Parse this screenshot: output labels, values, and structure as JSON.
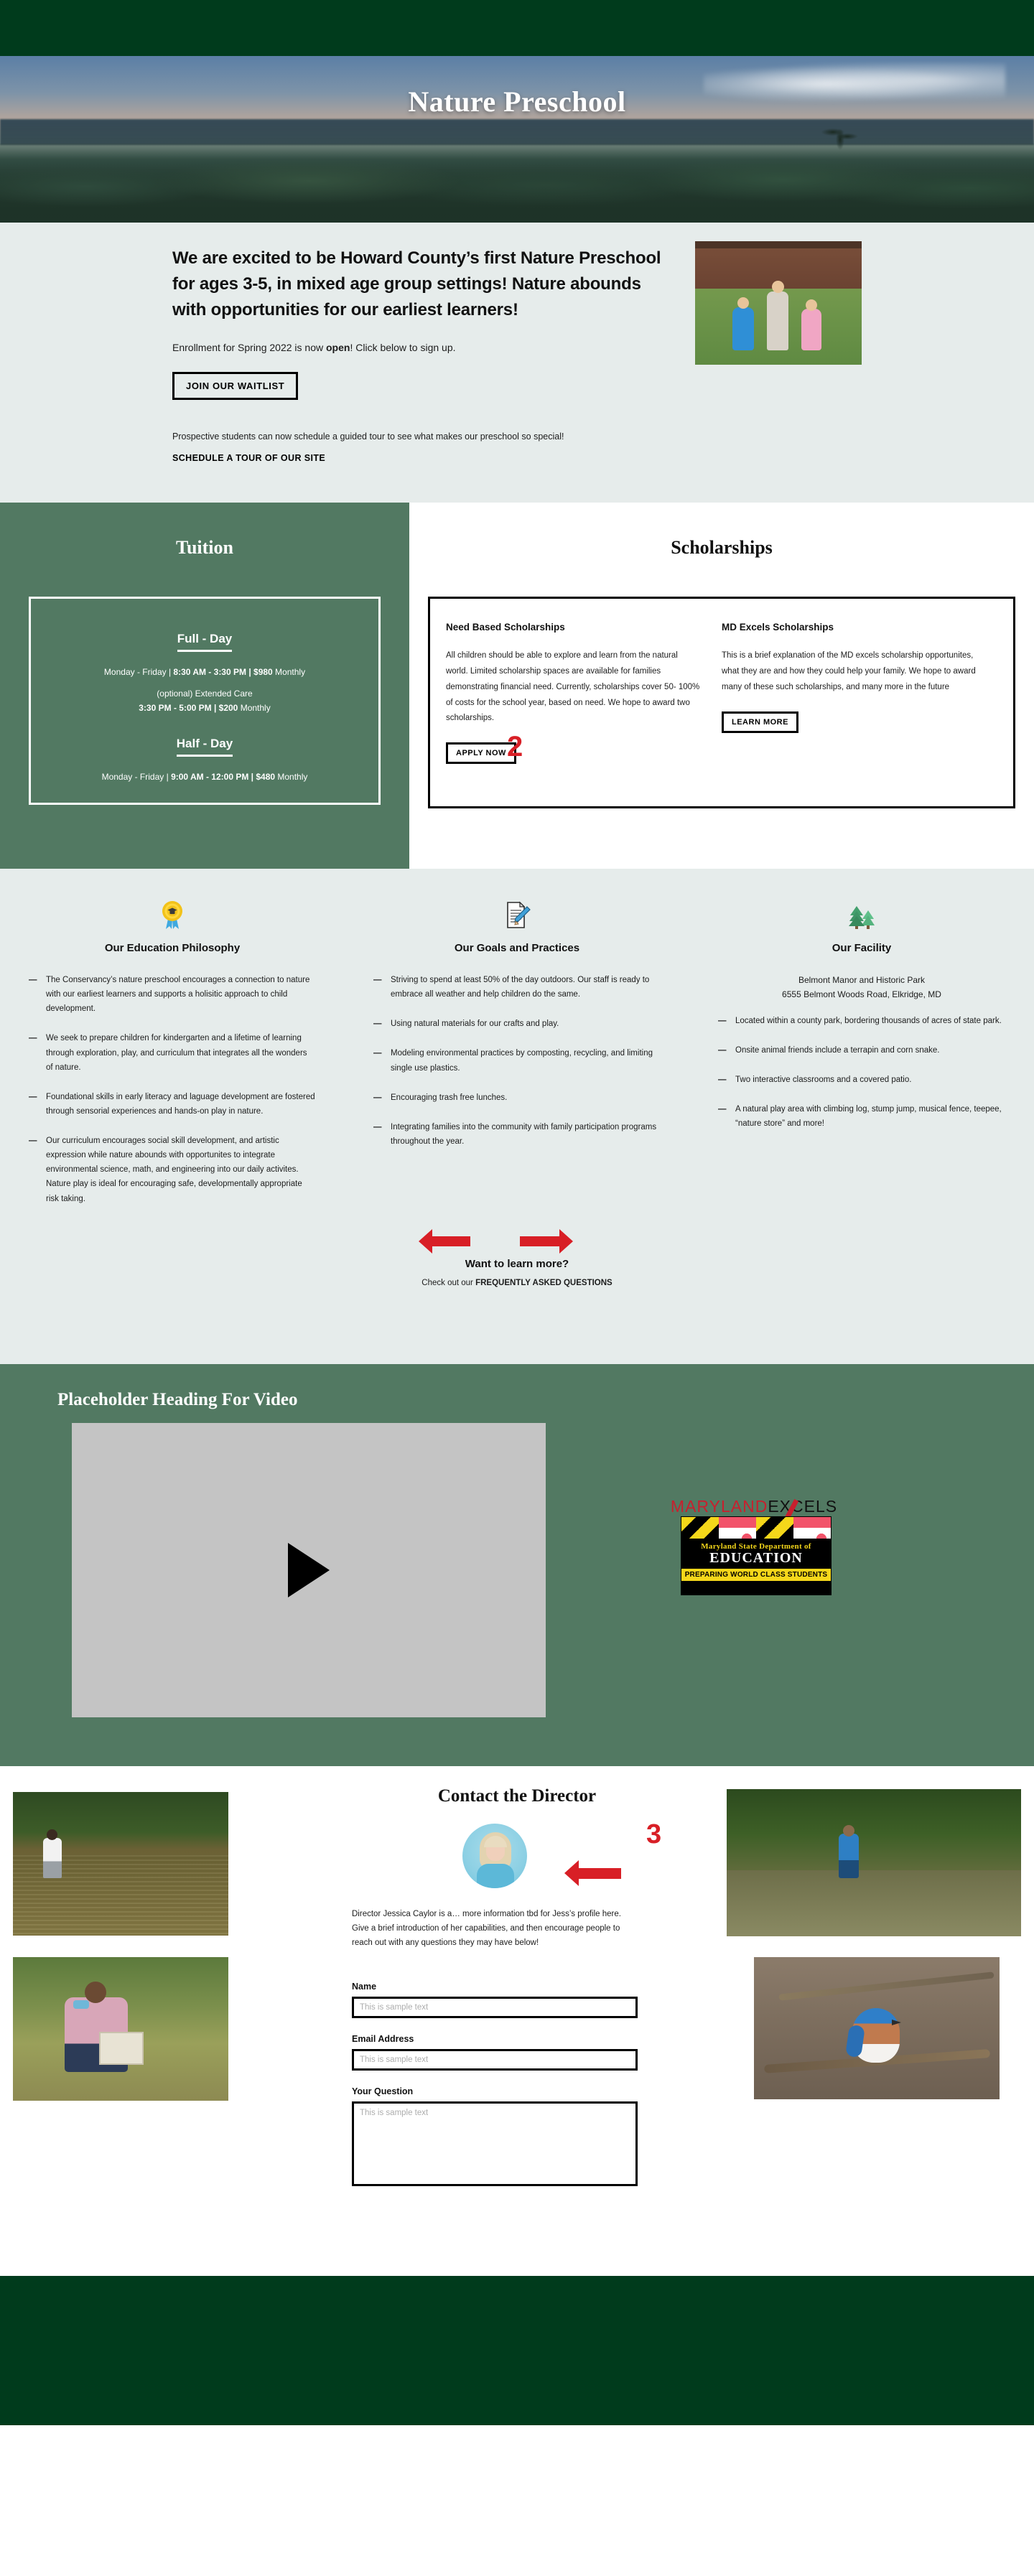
{
  "hero": {
    "title": "Nature Preschool"
  },
  "intro": {
    "heading": "We are excited to be Howard County’s first Nature Preschool for ages 3-5, in mixed age group settings! Nature abounds with opportunities for our earliest learners!",
    "enroll_prefix": "Enrollment for Spring 2022 is now ",
    "enroll_bold": "open",
    "enroll_suffix": "! Click below to sign up.",
    "waitlist_button": "JOIN OUR WAITLIST",
    "tour_text": "Prospective students can now schedule a guided tour to see what makes our preschool so special!",
    "tour_link": "SCHEDULE A TOUR OF OUR SITE"
  },
  "annotations": {
    "one": "1",
    "two": "2",
    "three": "3"
  },
  "tuition": {
    "title": "Tuition",
    "full_day_title": "Full - Day",
    "full_day_line_1a": "Monday - Friday | ",
    "full_day_line_1b": "8:30 AM - 3:30 PM | $980",
    "full_day_line_1c": " Monthly",
    "extended_label": "(optional) Extended Care",
    "extended_time_b": "3:30 PM - 5:00 PM | $200",
    "extended_time_c": " Monthly",
    "half_day_title": "Half - Day",
    "half_day_line_1a": "Monday - Friday | ",
    "half_day_line_1b": "9:00 AM - 12:00 PM | $480",
    "half_day_line_1c": " Monthly"
  },
  "scholarships": {
    "title": "Scholarships",
    "cards": [
      {
        "title": "Need Based Scholarships",
        "body": "All children should be able to explore and learn from the natural world. Limited scholarship spaces are available for families demonstrating financial need. Currently, scholarships cover 50- 100% of costs for the school year, based on need. We hope to award two scholarships.",
        "button": "APPLY NOW"
      },
      {
        "title": "MD Excels Scholarships",
        "body": "This is a brief explanation of the MD excels scholarship opportunites, what they are and how they could help your family. We hope to award many of these such scholarships, and many more in the future",
        "button": "LEARN MORE"
      }
    ]
  },
  "columns": [
    {
      "icon": "award-ribbon-icon",
      "heading": "Our Education Philosophy",
      "bullets": [
        "The Conservancy’s nature preschool encourages a connection to nature with our earliest learners and supports a holisitic approach to child development.",
        "We seek to prepare children for kindergarten and a lifetime of learning through exploration, play, and curriculum that integrates all the wonders of nature.",
        "Foundational skills in early literacy and laguage development are fostered through sensorial experiences and hands-on play in nature.",
        "Our curriculum encourages social skill development, and artistic expression while nature abounds with opportunites to integrate environmental science, math, and engineering into our daily activites. Nature play is ideal for encouraging safe, developmentally appropriate risk taking."
      ]
    },
    {
      "icon": "memo-pencil-icon",
      "heading": "Our Goals and Practices",
      "bullets": [
        "Striving to spend at least 50% of the day outdoors. Our staff is ready to embrace all weather and help children do the same.",
        "Using natural materials for our crafts and play.",
        "Modeling environmental practices by composting, recycling, and limiting  single use plastics.",
        "Encouraging trash free lunches.",
        "Integrating families into the community with family participation programs throughout the year."
      ]
    },
    {
      "icon": "evergreen-trees-icon",
      "heading": "Our Facility",
      "address_line_1": "Belmont Manor and Historic Park",
      "address_line_2": "6555 Belmont Woods Road, Elkridge, MD",
      "bullets": [
        "Located within a county park, bordering thousands of acres of state park.",
        "Onsite animal friends include a terrapin and corn snake.",
        "Two interactive classrooms and a covered patio.",
        "A natural play area with climbing log, stump jump, musical fence, teepee, “nature store” and more!"
      ]
    }
  ],
  "learn_more": {
    "heading": "Want to learn more?",
    "prefix": "Check out our ",
    "link": "FREQUENTLY ASKED QUESTIONS"
  },
  "video": {
    "heading": "Placeholder Heading For Video",
    "play_icon": "play-triangle-icon"
  },
  "badges": {
    "md_excels_red": "MARYLAND",
    "md_excels_black": "EXCELS",
    "msde_line1": "Maryland State Department of",
    "msde_line2": "EDUCATION",
    "msde_line3": "PREPARING WORLD CLASS STUDENTS"
  },
  "contact": {
    "title": "Contact the Director",
    "bio": "Director Jessica Caylor is a… more information tbd for Jess’s profile here. Give a brief introduction of her capabilities, and then encourage people to reach out with any questions they may have below!",
    "fields": [
      {
        "label": "Name",
        "placeholder": "This is sample text",
        "value": ""
      },
      {
        "label": "Email Address",
        "placeholder": "This is sample text",
        "value": ""
      },
      {
        "label": "Your Question",
        "placeholder": "This is sample text",
        "value": ""
      }
    ]
  },
  "colors": {
    "dark_green": "#003b1c",
    "sage_green": "#527962",
    "pale_mint": "#e6eceb",
    "annotation_red": "#d81f26",
    "excels_red": "#c8202e"
  }
}
